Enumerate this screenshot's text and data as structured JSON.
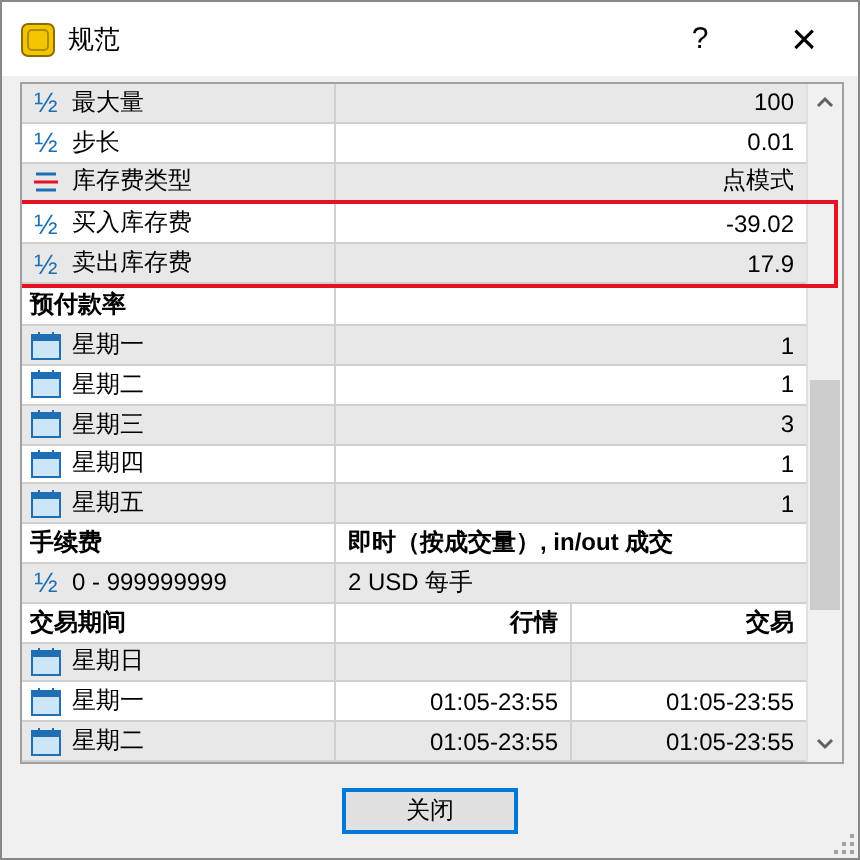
{
  "window": {
    "title": "规范",
    "help": "?",
    "close": "×"
  },
  "sections": [
    {
      "rows": [
        {
          "kind": "param",
          "symbol": "½",
          "label": "最大量",
          "values": [
            "100"
          ],
          "highlighted": false
        },
        {
          "kind": "param",
          "symbol": "½",
          "label": "步长",
          "values": [
            "0.01"
          ],
          "highlighted": false
        },
        {
          "kind": "enum",
          "label": "库存费类型",
          "values": [
            "点模式"
          ],
          "highlighted": false
        },
        {
          "kind": "param",
          "symbol": "½",
          "label": "买入库存费",
          "values": [
            "-39.02"
          ],
          "highlighted": true
        },
        {
          "kind": "param",
          "symbol": "½",
          "label": "卖出库存费",
          "values": [
            "17.9"
          ],
          "highlighted": true
        }
      ]
    },
    {
      "title": "预付款率",
      "rows": [
        {
          "kind": "day",
          "label": "星期一",
          "values": [
            "1"
          ],
          "highlighted": false
        },
        {
          "kind": "day",
          "label": "星期二",
          "values": [
            "1"
          ],
          "highlighted": false
        },
        {
          "kind": "day",
          "label": "星期三",
          "values": [
            "3"
          ],
          "highlighted": false
        },
        {
          "kind": "day",
          "label": "星期四",
          "values": [
            "1"
          ],
          "highlighted": false
        },
        {
          "kind": "day",
          "label": "星期五",
          "values": [
            "1"
          ],
          "highlighted": false
        }
      ]
    },
    {
      "title": "手续费",
      "values": [
        "即时（按成交量）, in/out 成交"
      ],
      "rows": [
        {
          "kind": "param",
          "symbol": "½",
          "label": "0 - 999999999",
          "values": [
            "2 USD 每手"
          ],
          "highlighted": false
        }
      ]
    },
    {
      "title": "交易期间",
      "values": [
        "行情",
        "交易"
      ],
      "rows": [
        {
          "kind": "day",
          "label": "星期日",
          "highlighted": false
        },
        {
          "kind": "day",
          "label": "星期一",
          "values": [
            "01:05-23:55",
            "01:05-23:55"
          ],
          "highlighted": false
        },
        {
          "kind": "day",
          "label": "星期二",
          "values": [
            "01:05-23:55",
            "01:05-23:55"
          ],
          "highlighted": false
        }
      ]
    }
  ],
  "button": "关闭"
}
